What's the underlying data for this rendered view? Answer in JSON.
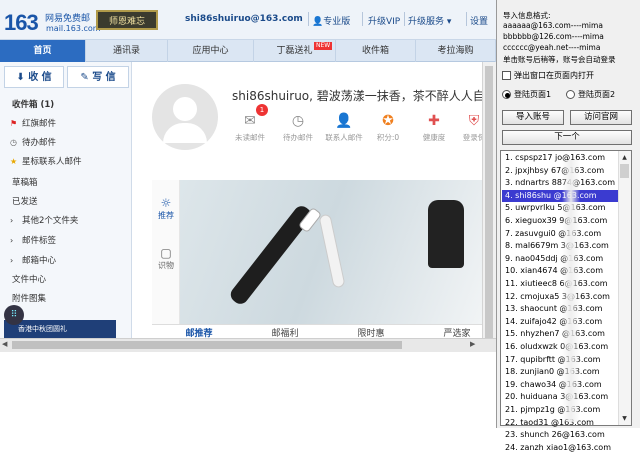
{
  "header": {
    "logo": "163",
    "brand_cn": "网易免费邮",
    "brand_domain": "mail.163.com",
    "badge_text": "师恩难忘",
    "user_email": "shi86shuiruo@163.com",
    "links": [
      "专业版",
      "升级VIP",
      "升级服务",
      "设置"
    ]
  },
  "nav": {
    "tabs": [
      "首页",
      "通讯录",
      "应用中心",
      "丁磊送礼",
      "收件箱",
      "考拉海购"
    ],
    "new_badge": "NEW"
  },
  "sidebar": {
    "receive": "收 信",
    "write": "写 信",
    "items": [
      "收件箱 (1)",
      "红旗邮件",
      "待办邮件",
      "星标联系人邮件",
      "草稿箱",
      "已发送",
      "其他2个文件夹",
      "邮件标签",
      "邮箱中心",
      "文件中心",
      "附件图集"
    ],
    "banner": "香港中秋团圆礼"
  },
  "main": {
    "greeting": "shi86shuiruo,  碧波荡漾一抹香，茶不醉人人自醉",
    "unread_count": "1",
    "stats": [
      "未读邮件",
      "待办邮件",
      "联系人邮件",
      "积分:0",
      "健康度",
      "登录保"
    ],
    "promo_side": [
      "推荐",
      "识物"
    ],
    "bottom_tabs": [
      "邮推荐",
      "邮福利",
      "限时惠",
      "严选家"
    ]
  },
  "tool": {
    "info_lines": [
      "导入信息格式:",
      "aaaaaa@163.com----mima",
      "bbbbbb@126.com----mima",
      "cccccc@yeah.net----mima",
      "单击账号后稍等，账号会自动登录"
    ],
    "popup_label": "弹出窗口在页面内打开",
    "radio1": "登陆页面1",
    "radio2": "登陆页面2",
    "import_button": "导入账号",
    "visit_button": "访问官网",
    "next_button": "下一个",
    "accounts": [
      "1.  cspspz17   jo@163.com",
      "2.  jpxjhbsy    67@163.com",
      "3.  ndnartrs    8874@163.com",
      "4.  shi86shu    @163.com",
      "5.  uwrpvrlku    5@163.com",
      "6.  xieguox39    9@163.com",
      "7.  zasuvgui0    @163.com",
      "8.  mal6679m    3@163.com",
      "9.  nao045ddj    @163.com",
      "10.  xian4674    @163.com",
      "11.  xiutieec8    6@163.com",
      "12.  cmojuxa5    3@163.com",
      "13.  shaocunt    @163.com",
      "14.  zuifajo42    @163.com",
      "15.  nhyzhen7    @163.com",
      "16.  oludxwzk    0@163.com",
      "17.  qupibrftt    @163.com",
      "18.  zunjian0    @163.com",
      "19.  chawo34    @163.com",
      "20.  huiduana    3@163.com",
      "21.  pjmpz1g    @163.com",
      "22.  taod31    @163.com",
      "23.  shunch    26@163.com",
      "24.  zanzh    xiao1@163.com"
    ]
  }
}
